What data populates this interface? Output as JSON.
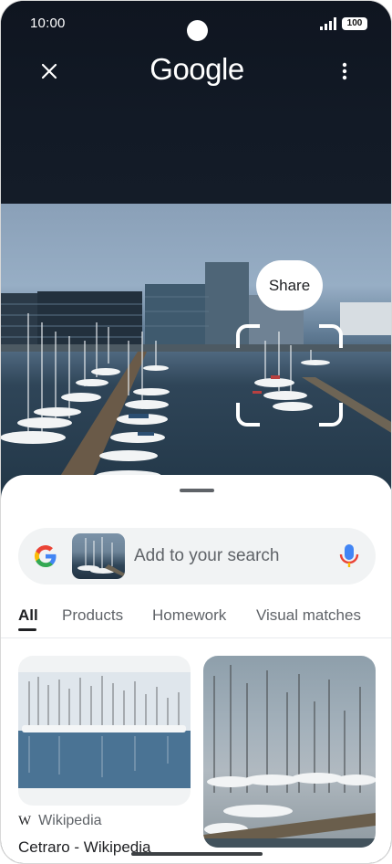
{
  "status": {
    "time": "10:00",
    "battery": "100"
  },
  "header": {
    "title": "Google",
    "close_icon": "close-icon",
    "more_icon": "more-vert-icon"
  },
  "photo": {
    "share_label": "Share"
  },
  "search": {
    "placeholder": "Add to your search"
  },
  "tabs": [
    {
      "label": "All"
    },
    {
      "label": "Products"
    },
    {
      "label": "Homework"
    },
    {
      "label": "Visual matches"
    }
  ],
  "results": [
    {
      "source": "Wikipedia",
      "title": "Cetraro - Wikipedia"
    }
  ],
  "colors": {
    "google_blue": "#4285F4",
    "google_red": "#EA4335",
    "google_yellow": "#FBBC05",
    "google_green": "#34A853"
  }
}
